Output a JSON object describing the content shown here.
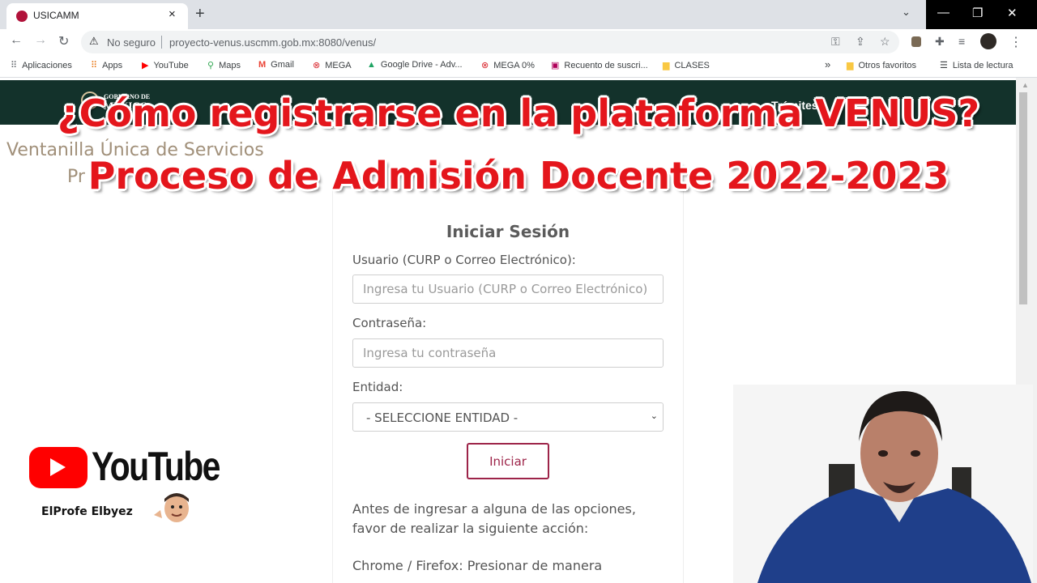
{
  "browser": {
    "tab_title": "USICAMM",
    "tab_close": "×",
    "new_tab": "+",
    "tab_menu": "⌄",
    "window_buttons": {
      "minimize": "—",
      "restore": "❐",
      "close": "✕"
    },
    "nav": {
      "back": "←",
      "forward": "→",
      "reload": "↻"
    },
    "security_icon": "⚠",
    "security_label": "No seguro",
    "url": "proyecto-venus.uscmm.gob.mx:8080/venus/",
    "omnibox_icons": {
      "key": "⚿",
      "share": "⇪",
      "star": "☆"
    },
    "toolbar_icons": {
      "extension": "✚",
      "media": "≡",
      "menu": "⋮"
    },
    "bookmarks": [
      {
        "icon": "⠿",
        "label": "Aplicaciones",
        "color": "#5f6368"
      },
      {
        "icon": "⠿",
        "label": "Apps",
        "color": "#e8710a"
      },
      {
        "icon": "▶",
        "label": "YouTube",
        "color": "#ff0000"
      },
      {
        "icon": "⚲",
        "label": "Maps",
        "color": "#34a853"
      },
      {
        "icon": "M",
        "label": "Gmail",
        "color": "#ea4335"
      },
      {
        "icon": "⊗",
        "label": "MEGA",
        "color": "#d9272e"
      },
      {
        "icon": "▲",
        "label": "Google Drive - Adv...",
        "color": "#1fa463"
      },
      {
        "icon": "⊗",
        "label": "MEGA 0%",
        "color": "#d9272e"
      },
      {
        "icon": "▣",
        "label": "Recuento de suscri...",
        "color": "#b0005a"
      },
      {
        "icon": "▆",
        "label": "CLASES",
        "color": "#f9c843"
      }
    ],
    "bookmarks_overflow": "»",
    "other_favorites": {
      "icon": "▆",
      "label": "Otros favoritos"
    },
    "reading_list": {
      "icon": "☰",
      "label": "Lista de lectura"
    }
  },
  "gov_header": {
    "line1": "GOBIERNO DE",
    "line2": "MÉXICO",
    "tramites": "Trámites",
    "search_icon": "⚲"
  },
  "page": {
    "ventanilla": "Ventanilla Única de Servicios",
    "programas": "Pr",
    "login_title": "Iniciar Sesión",
    "usuario_label": "Usuario (CURP o Correo Electrónico):",
    "usuario_placeholder": "Ingresa tu Usuario (CURP o Correo Electrónico)",
    "password_label": "Contraseña:",
    "password_placeholder": "Ingresa tu contraseña",
    "entidad_label": "Entidad:",
    "entidad_selected": "- SELECCIONE ENTIDAD -",
    "entidad_caret": "⌄",
    "submit_label": "Iniciar",
    "info_line1": "Antes de ingresar a alguna de las opciones,",
    "info_line2": "favor de realizar la siguiente acción:",
    "browser_hint": "Chrome / Firefox: Presionar de manera"
  },
  "overlay": {
    "title_line1": "¿Cómo registrarse en la plataforma VENUS?",
    "title_line2": "Proceso de Admisión Docente 2022-2023",
    "youtube_word": "YouTube",
    "channel_name": "ElProfe Elbyez"
  },
  "colors": {
    "gov_green": "#13322b",
    "gov_gold": "#a1907a",
    "accent": "#9d2449",
    "overlay_red": "#e4161c",
    "youtube_red": "#ff0000"
  }
}
